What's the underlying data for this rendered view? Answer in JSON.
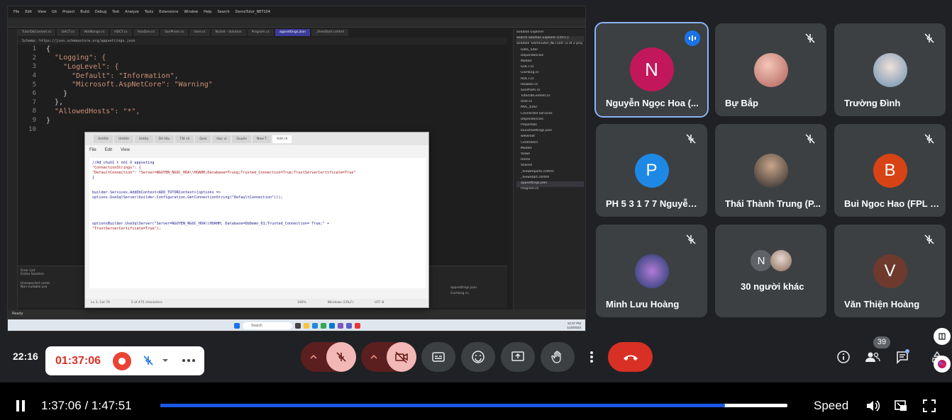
{
  "shared_screen": {
    "vs_menu": [
      "File",
      "Edit",
      "View",
      "Git",
      "Project",
      "Build",
      "Debug",
      "Test",
      "Analyze",
      "Tools",
      "Extensions",
      "Window",
      "Help",
      "Search",
      "DemoTutor_NET104"
    ],
    "editor_tabs": [
      "TutorDbContext.cs",
      "GHCT.cs",
      "NetNangs.cs",
      "HDCT.cs",
      "HoaDon.cs",
      "SanPham.cs",
      "User.cs",
      "NuGet - Solution",
      "Program.cs",
      "appsettings.json",
      "_ViewStart.cshtml"
    ],
    "active_tab": "appsettings.json",
    "schema": "Schema: https://json.schemastore.org/appsettings.json",
    "code_lines": [
      {
        "n": "1",
        "t": "{"
      },
      {
        "n": "2",
        "t": "  \"Logging\": {"
      },
      {
        "n": "3",
        "t": "    \"LogLevel\": {"
      },
      {
        "n": "4",
        "t": "      \"Default\": \"Information\","
      },
      {
        "n": "5",
        "t": "      \"Microsoft.AspNetCore\": \"Warning\""
      },
      {
        "n": "6",
        "t": "    }"
      },
      {
        "n": "7",
        "t": "  },"
      },
      {
        "n": "8",
        "t": "  \"AllowedHosts\": \"*\","
      },
      {
        "n": "9",
        "t": "}"
      },
      {
        "n": "10",
        "t": ""
      }
    ],
    "solution_explorer": {
      "title": "Solution Explorer",
      "search": "Search Solution Explorer (Ctrl+;)",
      "items": [
        "Solution 'DemoTutor_NET104' (2 of 2 proj",
        "Data_Tutor",
        "Dependencies",
        "Models",
        "GHCT.cs",
        "GioHang.cs",
        "HDCT.cs",
        "HoaDon.cs",
        "SanPham.cs",
        "TutorDbContext.cs",
        "User.cs",
        "MVC_tutor",
        "Connected Services",
        "Dependencies",
        "Properties",
        "launchSettings.json",
        "wwwroot",
        "Controllers",
        "Models",
        "Views",
        "Home",
        "Shared",
        "_ViewImports.cshtml",
        "_ViewStart.cshtml",
        "appsettings.json",
        "Program.cs"
      ]
    },
    "error_list": {
      "title": "Error List",
      "filter": "Entire Solution",
      "rows": [
        "Unexpected conte",
        "Non-nullable pro"
      ],
      "files": [
        "appsettings.json",
        "GioHang.cs"
      ]
    },
    "status": "Ready",
    "taskbar_search": "Search",
    "tray_time": "10:37 PM",
    "tray_date": "11/8/2023"
  },
  "notepad": {
    "tabs": [
      "Untitle",
      "Untitle",
      "Untity",
      "Dữ liệu",
      "Tất cả",
      "Quiz",
      "Học vi",
      "Quyền",
      "New T",
      "Add ch"
    ],
    "menu": [
      "File",
      "Edit",
      "View"
    ],
    "lines": [
      "//Ađ chuỗi t nối ở appseting",
      "\"ConnectionStrings\": {",
      "  \"DefaultConnection\": \"Server=NGUYEN_NGOC_HOA\\\\HOAHH;Database=Trung;Trusted_Connection=True;TrustServerCertificate=True\"",
      "}",
      "",
      "builder.Services.AddDbContext<ADO_TUTORContext>(options =>",
      "    options.UseSqlServer(builder.Configuration.GetConnectionString(\"DefaultConnection\")));",
      "",
      "optionsBuilder.UseSqlServer(\"Server=NGUYEN_NGOC_HOA\\\\HOAHH; Database=DbDemo_01;Trusted_Connection= True;\" +",
      "\"TrustServerCertificate=True\");"
    ],
    "status": {
      "pos": "Ln 3, Col 70",
      "chars": "5 of 475 characters",
      "zoom": "100%",
      "eol": "Windows (CRLF)",
      "enc": "UTF-8"
    }
  },
  "participants": [
    {
      "name": "Nguyễn Ngọc Hoa (...",
      "initial": "N",
      "color": "#c2185b",
      "speaking": true
    },
    {
      "name": "Bự Bắp",
      "initial": "",
      "color": "photo"
    },
    {
      "name": "Trường Đình",
      "initial": "",
      "color": "photo"
    },
    {
      "name": "PH 5 3 1 7 7 Nguyễn ...",
      "initial": "P",
      "color": "#1e88e5"
    },
    {
      "name": "Thái Thành Trung (P...",
      "initial": "",
      "color": "photo"
    },
    {
      "name": "Bui Ngoc Hao (FPL H...",
      "initial": "B",
      "color": "#d84315"
    },
    {
      "name": "Minh Lưu Hoàng",
      "initial": "",
      "color": "photo"
    },
    {
      "name": "30 người khác",
      "initial": "N",
      "color": "#5f6368"
    },
    {
      "name": "Văn Thiện Hoàng",
      "initial": "V",
      "color": "#6d3a2d"
    }
  ],
  "controls": {
    "clock": "22:16",
    "recording_time": "01:37:06",
    "people_count": "39"
  },
  "player": {
    "time": "1:37:06 / 1:47:51",
    "progress": 0.9,
    "speed_label": "Speed"
  }
}
